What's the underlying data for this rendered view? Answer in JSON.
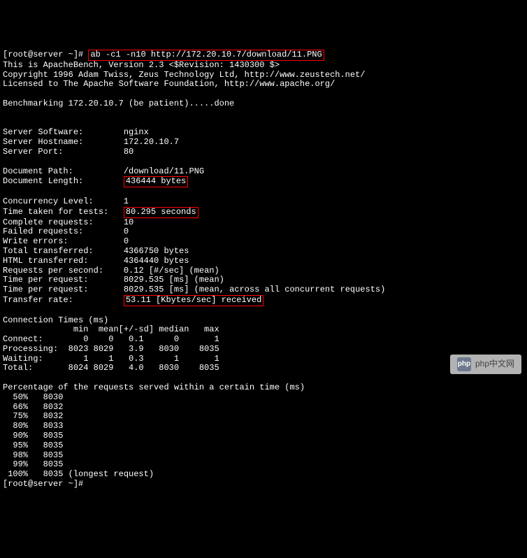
{
  "prompt_user": "root@server",
  "prompt_path": "~",
  "prompt_suffix": "]#",
  "command": "ab -c1 -n10 http://172.20.10.7/download/11.PNG",
  "header_lines": [
    "This is ApacheBench, Version 2.3 <$Revision: 1430300 $>",
    "Copyright 1996 Adam Twiss, Zeus Technology Ltd, http://www.zeustech.net/",
    "Licensed to The Apache Software Foundation, http://www.apache.org/"
  ],
  "benchmark_line": "Benchmarking 172.20.10.7 (be patient).....done",
  "server_info": {
    "software_label": "Server Software:",
    "software_value": "nginx",
    "hostname_label": "Server Hostname:",
    "hostname_value": "172.20.10.7",
    "port_label": "Server Port:",
    "port_value": "80"
  },
  "document_info": {
    "path_label": "Document Path:",
    "path_value": "/download/11.PNG",
    "length_label": "Document Length:",
    "length_value": "436444 bytes"
  },
  "stats": {
    "concurrency_label": "Concurrency Level:",
    "concurrency_value": "1",
    "time_taken_label": "Time taken for tests:",
    "time_taken_value": "80.295 seconds",
    "complete_label": "Complete requests:",
    "complete_value": "10",
    "failed_label": "Failed requests:",
    "failed_value": "0",
    "write_errors_label": "Write errors:",
    "write_errors_value": "0",
    "total_transferred_label": "Total transferred:",
    "total_transferred_value": "4366750 bytes",
    "html_transferred_label": "HTML transferred:",
    "html_transferred_value": "4364440 bytes",
    "rps_label": "Requests per second:",
    "rps_value": "0.12 [#/sec] (mean)",
    "tpr1_label": "Time per request:",
    "tpr1_value": "8029.535 [ms] (mean)",
    "tpr2_label": "Time per request:",
    "tpr2_value": "8029.535 [ms] (mean, across all concurrent requests)",
    "transfer_label": "Transfer rate:",
    "transfer_value": "53.11 [Kbytes/sec] received"
  },
  "conn_times_header": "Connection Times (ms)",
  "conn_times_cols": "              min  mean[+/-sd] median   max",
  "conn_times_rows": [
    "Connect:        0    0   0.1      0       1",
    "Processing:  8023 8029   3.9   8030    8035",
    "Waiting:        1    1   0.3      1       1",
    "Total:       8024 8029   4.0   8030    8035"
  ],
  "percentage_header": "Percentage of the requests served within a certain time (ms)",
  "percentage_rows": [
    "  50%   8030",
    "  66%   8032",
    "  75%   8032",
    "  80%   8033",
    "  90%   8035",
    "  95%   8035",
    "  98%   8035",
    "  99%   8035",
    " 100%   8035 (longest request)"
  ],
  "final_prompt": "[root@server ~]#",
  "watermark": {
    "logo_text": "php",
    "text": "php中文网"
  }
}
